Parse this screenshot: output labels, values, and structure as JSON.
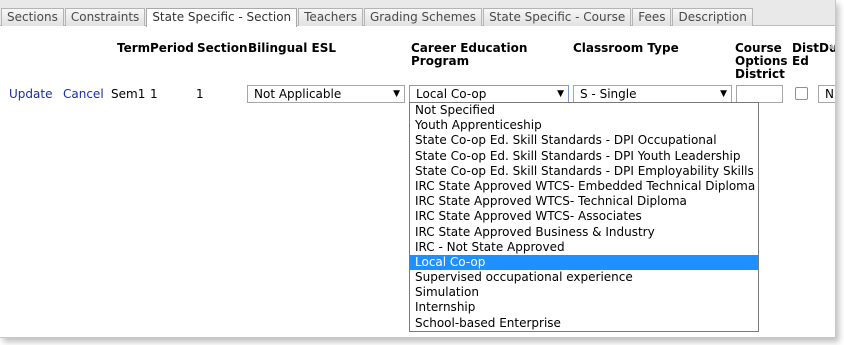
{
  "tabs": [
    {
      "label": "Sections",
      "active": false
    },
    {
      "label": "Constraints",
      "active": false
    },
    {
      "label": "State Specific - Section",
      "active": true
    },
    {
      "label": "Teachers",
      "active": false
    },
    {
      "label": "Grading Schemes",
      "active": false
    },
    {
      "label": "State Specific - Course",
      "active": false
    },
    {
      "label": "Fees",
      "active": false
    },
    {
      "label": "Description",
      "active": false
    }
  ],
  "columns": {
    "term": "Term",
    "period": "Period",
    "section": "Section",
    "bilingual": "Bilingual ESL",
    "career_line1": "Career Education",
    "career_line2": "Program",
    "classroom": "Classroom Type",
    "course_line1": "Course",
    "course_line2": "Options",
    "course_line3": "District",
    "dist_line1": "Dist",
    "dist_line2": "Ed",
    "du": "Du"
  },
  "row": {
    "update_label": "Update",
    "cancel_label": "Cancel",
    "term": "Sem1",
    "period": "1",
    "section": "1",
    "bilingual_value": "Not Applicable",
    "career_value": "Local Co-op",
    "classroom_value": "S - Single",
    "course_options_value": "",
    "du_value": "N"
  },
  "career_options": [
    "Not Specified",
    "Youth Apprenticeship",
    "State Co-op Ed. Skill Standards - DPI Occupational",
    "State Co-op Ed. Skill Standards - DPI Youth Leadership",
    "State Co-op Ed. Skill Standards - DPI Employability Skills",
    "IRC State Approved WTCS- Embedded Technical Diploma",
    "IRC State Approved WTCS- Technical Diploma",
    "IRC State Approved WTCS- Associates",
    "IRC State Approved Business & Industry",
    "IRC - Not State Approved",
    "Local Co-op",
    "Supervised occupational experience",
    "Simulation",
    "Internship",
    "School-based Enterprise"
  ],
  "selected_option_index": 10,
  "icons": {
    "dropdown_arrow": "▼",
    "scroll_up": "▲"
  },
  "colors": {
    "link": "#1a2ea5",
    "selected_option_bg": "#1e90ff"
  }
}
